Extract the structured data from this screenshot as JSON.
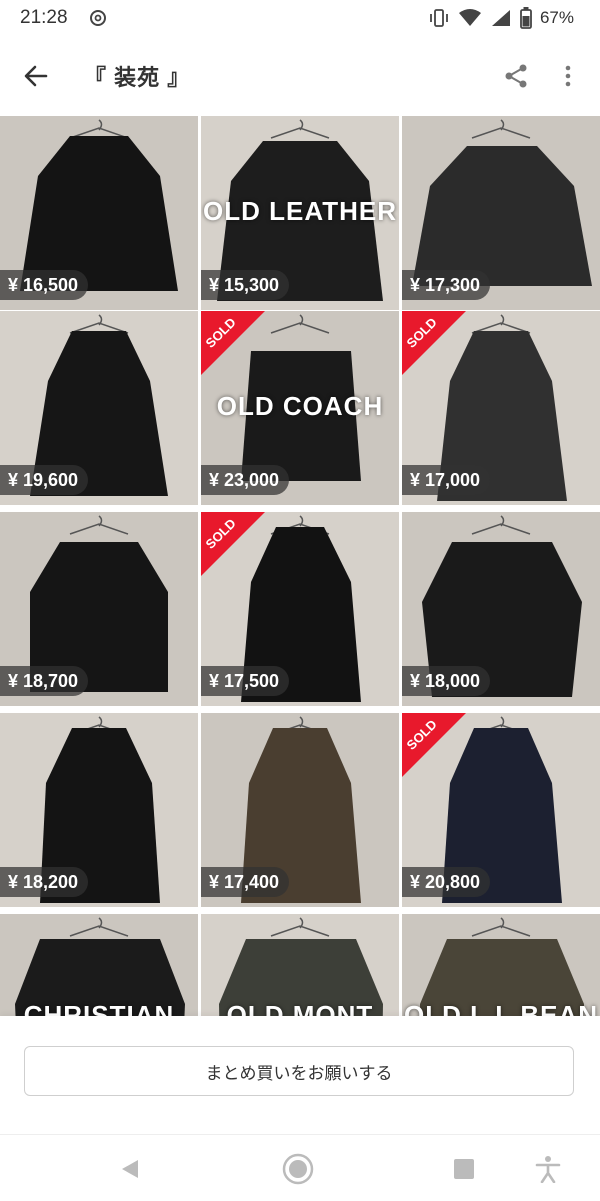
{
  "status_bar": {
    "time": "21:28",
    "battery_percent": "67%"
  },
  "app_bar": {
    "title": "『 装苑 』"
  },
  "items": [
    {
      "price": "¥ 16,500",
      "overlay": "",
      "sold": false,
      "sold_label": ""
    },
    {
      "price": "¥ 15,300",
      "overlay": "OLD LEATHER",
      "sold": false,
      "sold_label": ""
    },
    {
      "price": "¥ 17,300",
      "overlay": "",
      "sold": false,
      "sold_label": ""
    },
    {
      "price": "¥ 19,600",
      "overlay": "",
      "sold": false,
      "sold_label": ""
    },
    {
      "price": "¥ 23,000",
      "overlay": "OLD COACH",
      "sold": true,
      "sold_label": "SOLD"
    },
    {
      "price": "¥ 17,000",
      "overlay": "",
      "sold": true,
      "sold_label": "SOLD"
    },
    {
      "price": "¥ 18,700",
      "overlay": "",
      "sold": false,
      "sold_label": ""
    },
    {
      "price": "¥ 17,500",
      "overlay": "",
      "sold": true,
      "sold_label": "SOLD"
    },
    {
      "price": "¥ 18,000",
      "overlay": "",
      "sold": false,
      "sold_label": ""
    },
    {
      "price": "¥ 18,200",
      "overlay": "",
      "sold": false,
      "sold_label": ""
    },
    {
      "price": "¥ 17,400",
      "overlay": "",
      "sold": false,
      "sold_label": ""
    },
    {
      "price": "¥ 20,800",
      "overlay": "",
      "sold": true,
      "sold_label": "SOLD"
    },
    {
      "price": "",
      "overlay": "CHRISTIAN DIOR",
      "sold": false,
      "sold_label": ""
    },
    {
      "price": "",
      "overlay": "OLD MONT BELL",
      "sold": false,
      "sold_label": ""
    },
    {
      "price": "",
      "overlay": "OLD L.L.BEAN",
      "sold": false,
      "sold_label": ""
    }
  ],
  "action": {
    "bundle_button_label": "まとめ買いをお願いする"
  },
  "icons": {
    "back": "arrow-left-icon",
    "share": "share-icon",
    "more": "more-vertical-icon",
    "threads": "threads-icon",
    "vibrate": "vibrate-icon",
    "wifi": "wifi-icon",
    "signal": "signal-icon",
    "battery": "battery-icon",
    "nav_back": "nav-back-icon",
    "nav_home": "nav-home-icon",
    "nav_recents": "nav-recents-icon",
    "accessibility": "accessibility-icon"
  },
  "colors": {
    "sold_badge": "#e8192c",
    "price_tag_bg": "rgba(50,50,50,0.72)",
    "text": "#222222"
  }
}
